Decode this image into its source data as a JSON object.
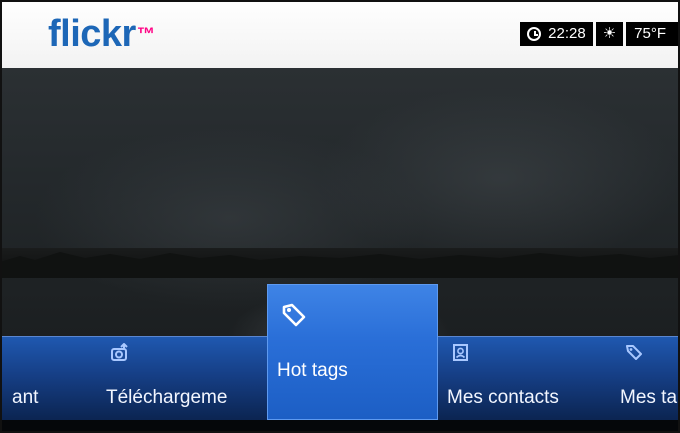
{
  "header": {
    "logo_text": "flickr",
    "logo_mark": "™",
    "time": "22:28",
    "temperature": "75°F",
    "clock_icon": "clock-icon",
    "weather_icon": "sun-icon"
  },
  "menu": {
    "items": [
      {
        "label": "ant",
        "icon": "none",
        "selected": false
      },
      {
        "label": "Téléchargeme",
        "icon": "upload-camera-icon",
        "selected": false
      },
      {
        "label": "Hot tags",
        "icon": "tag-icon",
        "selected": true
      },
      {
        "label": "Mes contacts",
        "icon": "contact-card-icon",
        "selected": false
      },
      {
        "label": "Mes ta",
        "icon": "tag-icon",
        "selected": false
      }
    ]
  },
  "colors": {
    "logo_blue": "#1d67b7",
    "logo_pink": "#ff0084",
    "menu_bar": "#1f58b0",
    "selected_tile": "#2a6fd8",
    "status_bg": "#000000"
  }
}
